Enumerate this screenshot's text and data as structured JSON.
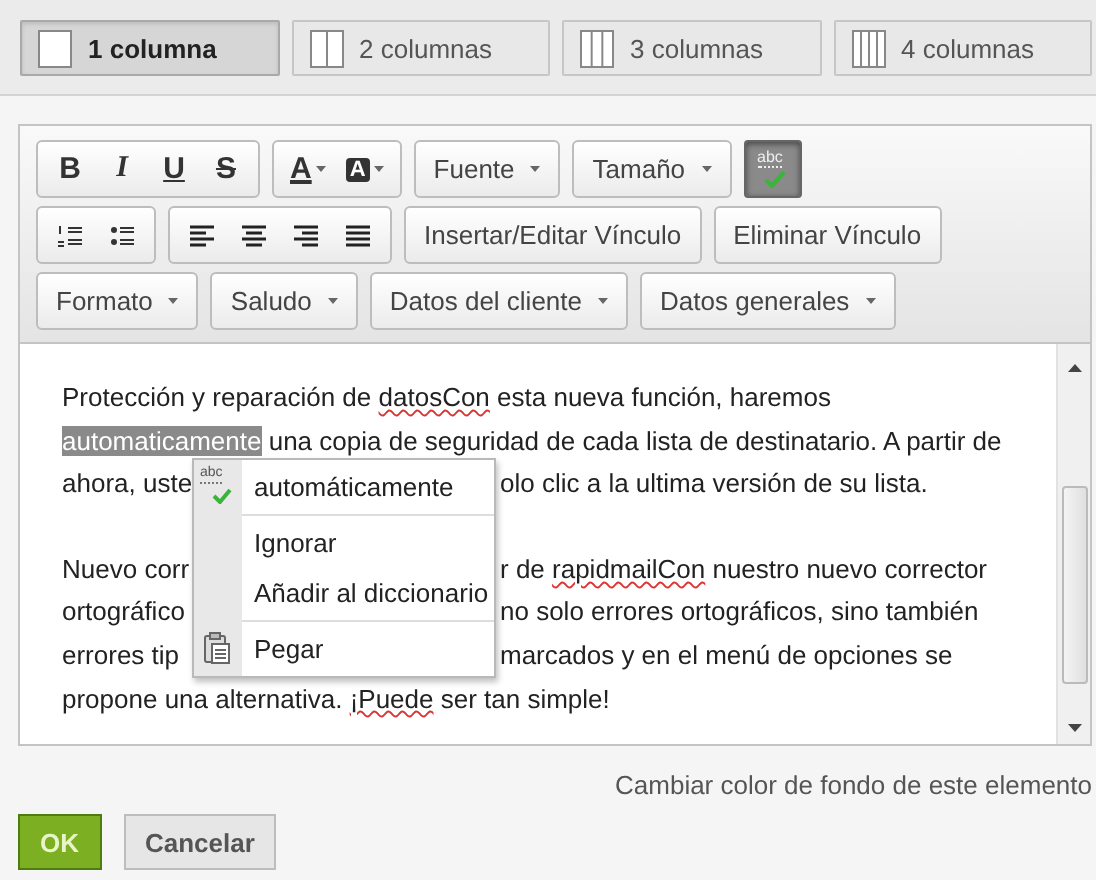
{
  "layout_tabs": [
    {
      "label": "1 columna",
      "kind": "one",
      "selected": true
    },
    {
      "label": "2 columnas",
      "kind": "two",
      "selected": false
    },
    {
      "label": "3 columnas",
      "kind": "three",
      "selected": false
    },
    {
      "label": "4 columnas",
      "kind": "four",
      "selected": false
    }
  ],
  "toolbar": {
    "rows": [
      {
        "items": [
          {
            "kind": "group",
            "buttons": [
              {
                "kind": "bold",
                "label": "B"
              },
              {
                "kind": "italic",
                "label": "I"
              },
              {
                "kind": "underline",
                "label": "U"
              },
              {
                "kind": "strike",
                "label": "S"
              }
            ]
          },
          {
            "kind": "group",
            "buttons": [
              {
                "kind": "text-color",
                "label": "A"
              },
              {
                "kind": "bg-color",
                "label": "A"
              }
            ]
          },
          {
            "kind": "dropdown",
            "label": "Fuente"
          },
          {
            "kind": "dropdown",
            "label": "Tamaño"
          },
          {
            "kind": "spellcheck",
            "label": "abc",
            "on": true
          }
        ]
      },
      {
        "items": [
          {
            "kind": "group",
            "buttons": [
              {
                "kind": "ordered-list"
              },
              {
                "kind": "bullet-list"
              }
            ]
          },
          {
            "kind": "group",
            "buttons": [
              {
                "kind": "align-left"
              },
              {
                "kind": "align-center"
              },
              {
                "kind": "align-right"
              },
              {
                "kind": "justify"
              }
            ]
          },
          {
            "kind": "button",
            "label": "Insertar/Editar Vínculo"
          },
          {
            "kind": "button",
            "label": "Eliminar Vínculo"
          }
        ]
      },
      {
        "items": [
          {
            "kind": "dropdown",
            "label": "Formato"
          },
          {
            "kind": "dropdown",
            "label": "Saludo"
          },
          {
            "kind": "dropdown",
            "label": "Datos del cliente"
          },
          {
            "kind": "dropdown",
            "label": "Datos generales"
          }
        ]
      }
    ]
  },
  "editor": {
    "paragraphs": [
      {
        "lines": [
          {
            "left": [
              {
                "text": "Protección y reparación de "
              },
              {
                "text": "datosCon",
                "misspelled": true
              },
              {
                "text": " esta nueva función, haremos"
              }
            ]
          },
          {
            "left": [
              {
                "text": "automaticamente",
                "selected": true
              },
              {
                "text": " una copia de seguridad de cada lista de destinatario. A partir de"
              }
            ]
          },
          {
            "left": [
              {
                "text": "ahora, uste"
              }
            ],
            "right": [
              {
                "text": "olo clic a la ultima versión de su lista."
              }
            ]
          }
        ]
      },
      {
        "lines": [
          {
            "left": [
              {
                "text": "Nuevo corr"
              }
            ],
            "right": [
              {
                "text": "r de "
              },
              {
                "text": "rapidmailCon",
                "misspelled": true
              },
              {
                "text": " nuestro nuevo corrector"
              }
            ]
          },
          {
            "left": [
              {
                "text": "ortográfico"
              }
            ],
            "right": [
              {
                "text": "no solo errores ortográficos, sino también"
              }
            ]
          },
          {
            "left": [
              {
                "text": "errores tip"
              }
            ],
            "right": [
              {
                "text": "marcados y en el menú de opciones se"
              }
            ]
          },
          {
            "left": [
              {
                "text": "propone una alternativa. "
              },
              {
                "text": "¡Puede",
                "misspelled": true
              },
              {
                "text": " ser tan simple!"
              }
            ]
          }
        ]
      }
    ]
  },
  "context_menu": [
    {
      "kind": "suggestion",
      "label": "automáticamente",
      "icon_label": "abc"
    },
    {
      "kind": "separator"
    },
    {
      "kind": "item",
      "label": "Ignorar"
    },
    {
      "kind": "item",
      "label": "Añadir al diccionario"
    },
    {
      "kind": "separator"
    },
    {
      "kind": "paste",
      "label": "Pegar"
    }
  ],
  "background_link": "Cambiar color de fondo de este elemento",
  "buttons": [
    {
      "kind": "primary",
      "label": "OK"
    },
    {
      "kind": "secondary",
      "label": "Cancelar"
    }
  ]
}
